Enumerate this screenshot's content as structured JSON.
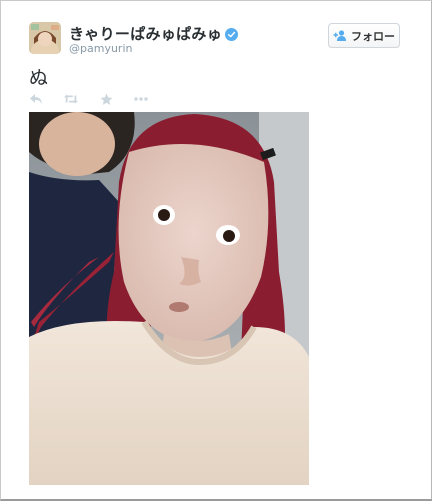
{
  "tweet": {
    "display_name": "きゃりーぱみゅぱみゅ",
    "handle": "@pamyurin",
    "text": "ぬ",
    "follow_label": "フォロー",
    "verified": true
  },
  "icons": {
    "verified": "verified-badge-icon",
    "follow": "add-user-icon",
    "reply": "reply-icon",
    "retweet": "retweet-icon",
    "favorite": "star-icon",
    "more": "more-dots-icon"
  },
  "colors": {
    "verified_blue": "#55acee",
    "action_gray": "#ccd6dd",
    "handle_gray": "#8899a6",
    "follow_icon_blue": "#55acee"
  }
}
